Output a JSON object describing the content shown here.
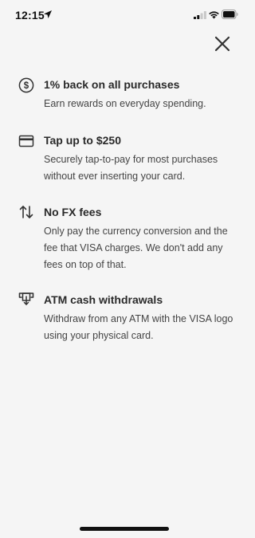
{
  "status_bar": {
    "time": "12:15"
  },
  "colors": {
    "background": "#f5f5f5",
    "text_primary": "#2a2a2a",
    "text_secondary": "#444444",
    "icon": "#333333"
  },
  "close_icon": "close-icon",
  "features": [
    {
      "icon": "dollar-circle-icon",
      "title": "1% back on all purchases",
      "description": "Earn rewards on everyday spending."
    },
    {
      "icon": "credit-card-icon",
      "title": "Tap up to $250",
      "description": "Securely tap-to-pay for most purchases without ever inserting your card."
    },
    {
      "icon": "exchange-arrows-icon",
      "title": "No FX fees",
      "description": "Only pay the currency conversion and the fee that VISA charges. We don't add any fees on top of that."
    },
    {
      "icon": "atm-withdraw-icon",
      "title": "ATM cash withdrawals",
      "description": "Withdraw from any ATM with the VISA logo using your physical card."
    }
  ]
}
